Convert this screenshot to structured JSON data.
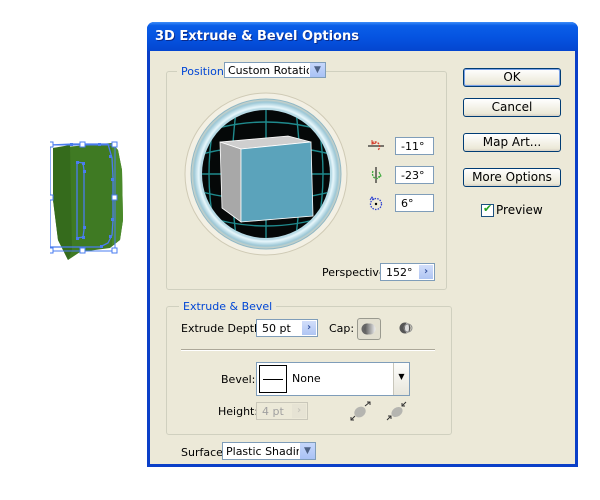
{
  "dialog": {
    "title": "3D Extrude & Bevel Options"
  },
  "position": {
    "label": "Position:",
    "preset": "Custom Rotation",
    "rotation": {
      "x_axis": "-11°",
      "y_axis": "-23°",
      "z_axis": "6°"
    },
    "perspective_label": "Perspective:",
    "perspective_value": "152°"
  },
  "extrude_bevel": {
    "legend": "Extrude & Bevel",
    "depth_label": "Extrude Depth:",
    "depth_value": "50 pt",
    "cap_label": "Cap:",
    "bevel_label": "Bevel:",
    "bevel_value": "None",
    "height_label": "Height:",
    "height_value": "4 pt"
  },
  "surface": {
    "label": "Surface:",
    "value": "Plastic Shading"
  },
  "buttons": {
    "ok": "OK",
    "cancel": "Cancel",
    "map_art": "Map Art...",
    "more_options": "More Options"
  },
  "preview": {
    "label": "Preview",
    "checked": true
  },
  "colors": {
    "title_bar": "#0553e0",
    "dialog_bg": "#ece9d8",
    "legend_text": "#0046d5",
    "cube_front": "#5ba3bb",
    "cube_side": "#a8a8a8",
    "cube_top": "#cfcfcf",
    "artwork_fill": "#3f7a23",
    "selection": "#4a7cf0"
  }
}
